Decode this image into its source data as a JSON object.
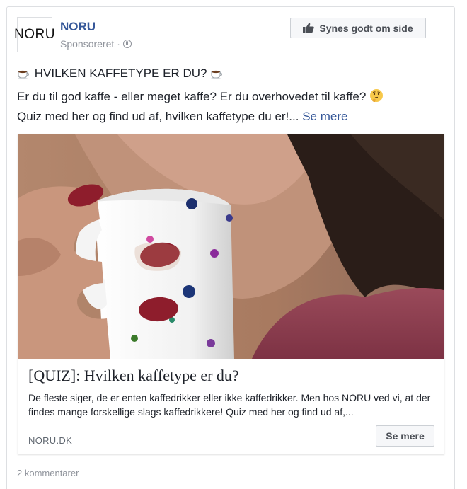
{
  "post": {
    "page_name": "NORU",
    "logo_text": "NORU",
    "sponsored": "Sponsoreret",
    "separator": "·",
    "like_page_label": "Synes godt om side",
    "headline": "HVILKEN KAFFETYPE ER DU?",
    "line2": "Er du til god kaffe - eller meget kaffe? Er du overhovedet til kaffe?",
    "line3": "Quiz med her og find ud af, hvilken kaffetype du er!...",
    "see_more": "Se mere"
  },
  "link_card": {
    "title": "[QUIZ]: Hvilken kaffetype er du?",
    "description": "De fleste siger, de er enten kaffedrikker eller ikke kaffedrikker. Men hos NORU ved vi, at der findes mange forskellige slags kaffedrikkere! Quiz med her og find ud af,...",
    "domain": "NORU.DK",
    "cta_label": "Se mere"
  },
  "footer": {
    "comments": "2 kommentarer"
  },
  "icons": {
    "coffee": "coffee-cup-icon",
    "thinking": "thinking-face-icon",
    "globe": "globe-icon",
    "like": "thumbs-up-icon"
  },
  "colors": {
    "link": "#365899",
    "muted": "#90949c",
    "button_bg": "#f6f7f9"
  }
}
